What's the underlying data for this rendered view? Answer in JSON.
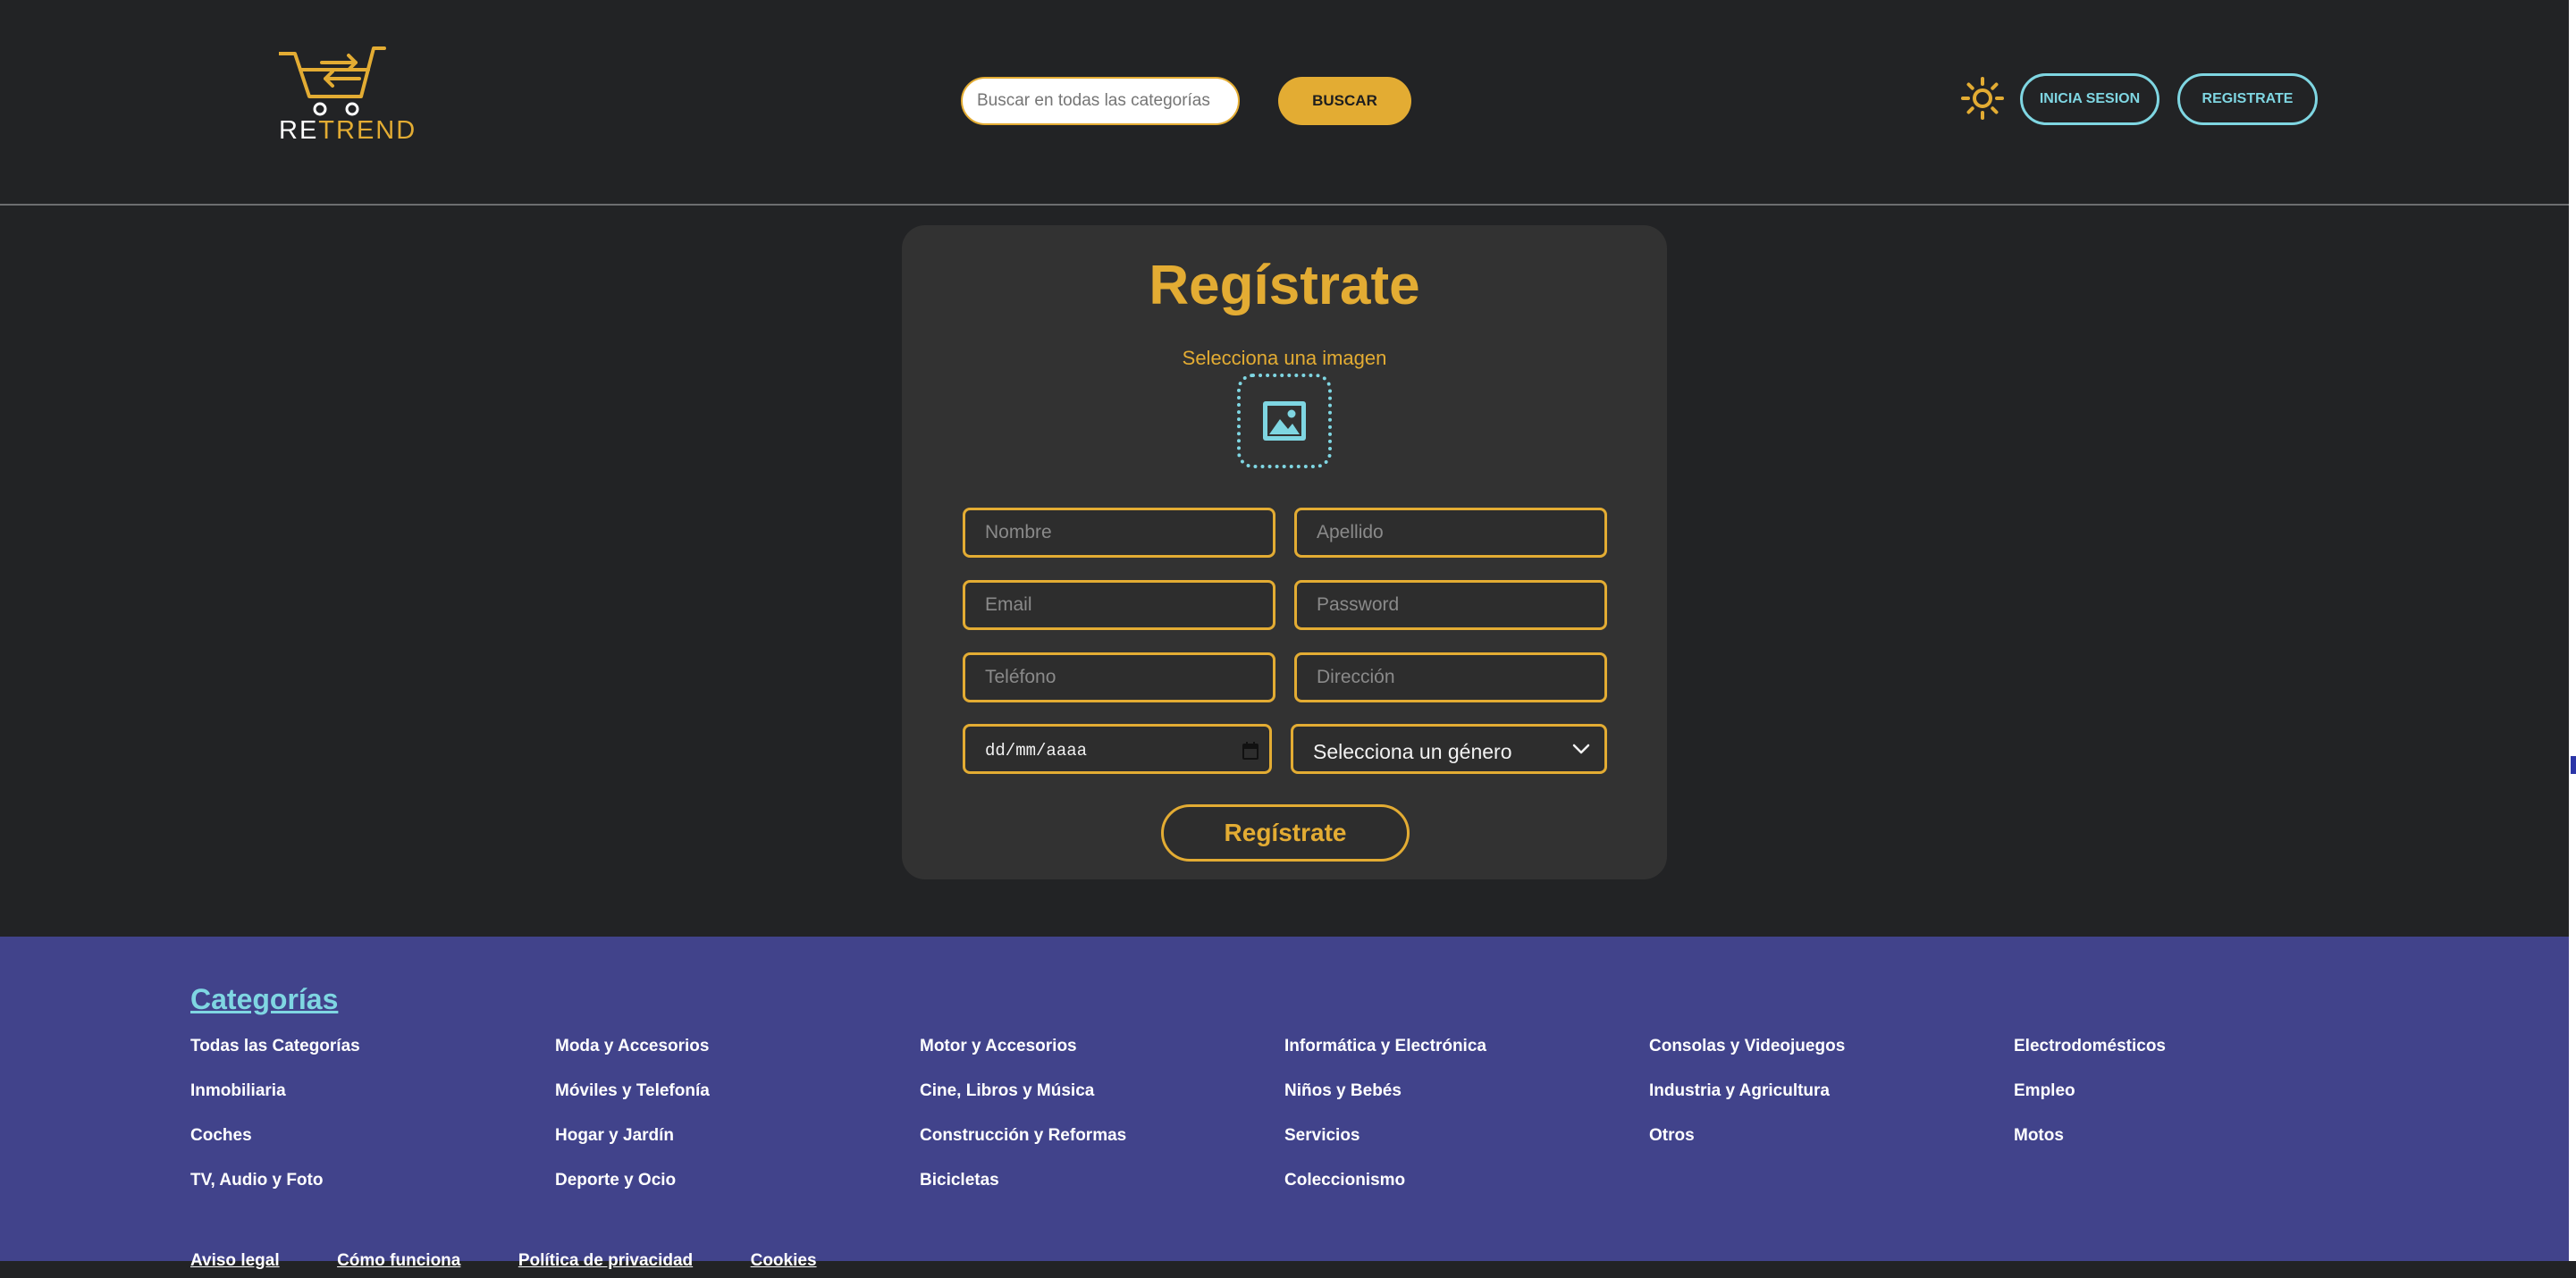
{
  "header": {
    "logo": {
      "part1": "RE",
      "part2": "TREND"
    },
    "search": {
      "placeholder": "Buscar en todas las categorías",
      "value": ""
    },
    "search_button": "BUSCAR",
    "theme_icon": "sun-icon",
    "login_button": "INICIA SESION",
    "register_button": "REGISTRATE"
  },
  "form": {
    "title": "Regístrate",
    "image_label": "Selecciona una imagen",
    "image_icon": "image-placeholder-icon",
    "fields": {
      "nombre": "Nombre",
      "apellido": "Apellido",
      "email": "Email",
      "password": "Password",
      "telefono": "Teléfono",
      "direccion": "Dirección"
    },
    "date_placeholder": "dd/mm/aaaa",
    "gender_select": "Selecciona un género",
    "submit": "Regístrate"
  },
  "footer": {
    "heading": "Categorías",
    "columns": [
      [
        "Todas las Categorías",
        "Inmobiliaria",
        "Coches",
        "TV, Audio y Foto"
      ],
      [
        "Moda y Accesorios",
        "Móviles y Telefonía",
        "Hogar y Jardín",
        "Deporte y Ocio"
      ],
      [
        "Motor y Accesorios",
        "Cine, Libros y Música",
        "Construcción y Reformas",
        "Bicicletas"
      ],
      [
        "Informática y Electrónica",
        "Niños y Bebés",
        "Servicios",
        "Coleccionismo"
      ],
      [
        "Consolas y Videojuegos",
        "Industria y Agricultura",
        "Otros"
      ],
      [
        "Electrodomésticos",
        "Empleo",
        "Motos"
      ]
    ],
    "bottom_links": [
      "Aviso legal",
      "Cómo funciona",
      "Política de privacidad",
      "Cookies"
    ]
  },
  "colors": {
    "accent": "#e3ac33",
    "secondary": "#7fd6e2",
    "background": "#222325",
    "card": "#323232",
    "footer": "#41438b"
  }
}
